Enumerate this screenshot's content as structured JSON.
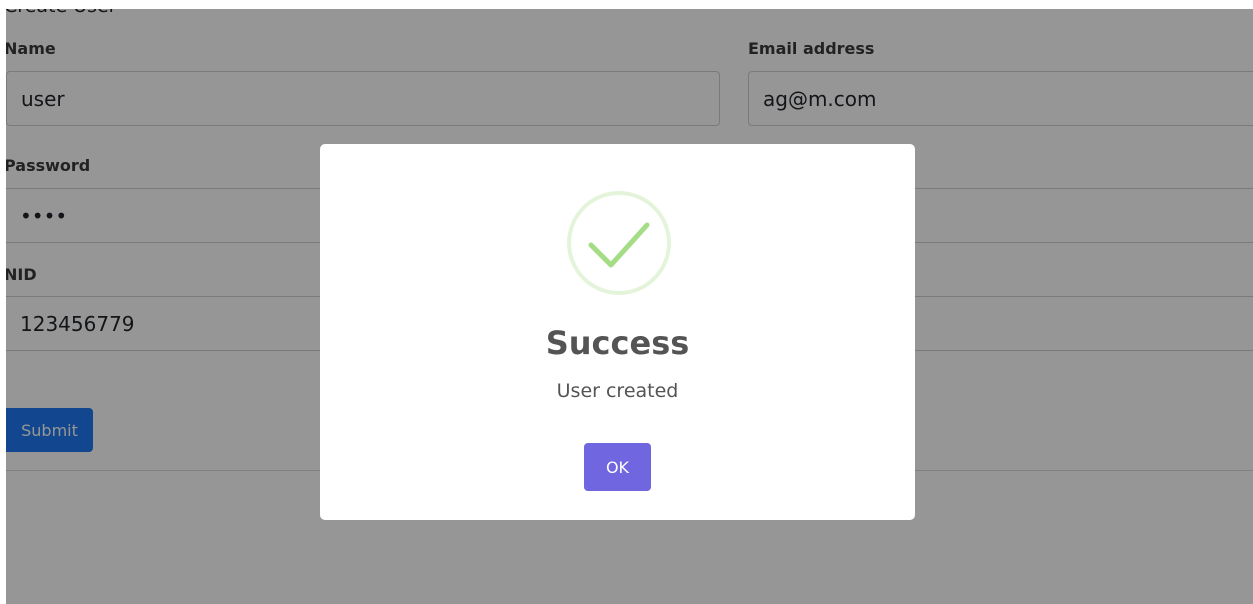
{
  "form": {
    "title": "Create User",
    "name_label": "Name",
    "name_value": "user",
    "email_label": "Email address",
    "email_value": "ag@m.com",
    "password_label": "Password",
    "password_value": "••••",
    "nid_label": "NID",
    "nid_value": "123456779",
    "submit_label": "Submit"
  },
  "modal": {
    "icon": "success-check-icon",
    "title": "Success",
    "message": "User created",
    "ok_label": "OK",
    "accent_color": "#a5dc86",
    "button_color": "#7066e0"
  }
}
